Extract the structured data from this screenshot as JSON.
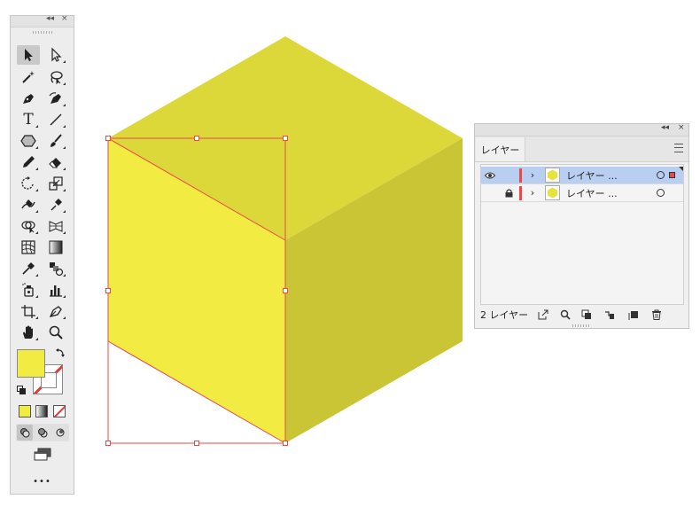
{
  "tools_panel": {
    "collapse_label": "◂◂",
    "close_label": "×",
    "tools": [
      {
        "name": "selection-tool-icon",
        "active": true
      },
      {
        "name": "direct-selection-tool-icon"
      },
      {
        "name": "magic-wand-tool-icon"
      },
      {
        "name": "lasso-tool-icon"
      },
      {
        "name": "pen-tool-icon"
      },
      {
        "name": "curvature-tool-icon"
      },
      {
        "name": "type-tool-icon",
        "glyph": "T"
      },
      {
        "name": "line-segment-tool-icon"
      },
      {
        "name": "polygon-tool-icon"
      },
      {
        "name": "paintbrush-tool-icon"
      },
      {
        "name": "pencil-tool-icon"
      },
      {
        "name": "eraser-tool-icon"
      },
      {
        "name": "rotate-tool-icon"
      },
      {
        "name": "scale-tool-icon"
      },
      {
        "name": "warp-tool-icon"
      },
      {
        "name": "puppet-warp-tool-icon"
      },
      {
        "name": "shape-builder-tool-icon"
      },
      {
        "name": "perspective-grid-tool-icon"
      },
      {
        "name": "mesh-tool-icon"
      },
      {
        "name": "gradient-tool-icon"
      },
      {
        "name": "eyedropper-tool-icon"
      },
      {
        "name": "blend-tool-icon"
      },
      {
        "name": "symbol-sprayer-tool-icon"
      },
      {
        "name": "column-graph-tool-icon"
      },
      {
        "name": "artboard-tool-icon"
      },
      {
        "name": "slice-tool-icon"
      },
      {
        "name": "hand-tool-icon"
      },
      {
        "name": "zoom-tool-icon"
      }
    ],
    "fill_color": "#f2eb41",
    "stroke": "none",
    "more_label": "•••"
  },
  "canvas": {
    "cube_top_color": "#ddd83a",
    "cube_right_color": "#c9c535",
    "cube_left_color": "#f2eb41",
    "selection_color": "#e84a4a"
  },
  "layers_panel": {
    "collapse_label": "◂◂",
    "close_label": "×",
    "tab_label": "レイヤー",
    "layers": [
      {
        "name": "レイヤー ...",
        "selected": true,
        "visible": true,
        "locked": false
      },
      {
        "name": "レイヤー ...",
        "selected": false,
        "visible": false,
        "locked": true
      }
    ],
    "count_label": "2 レイヤー"
  }
}
